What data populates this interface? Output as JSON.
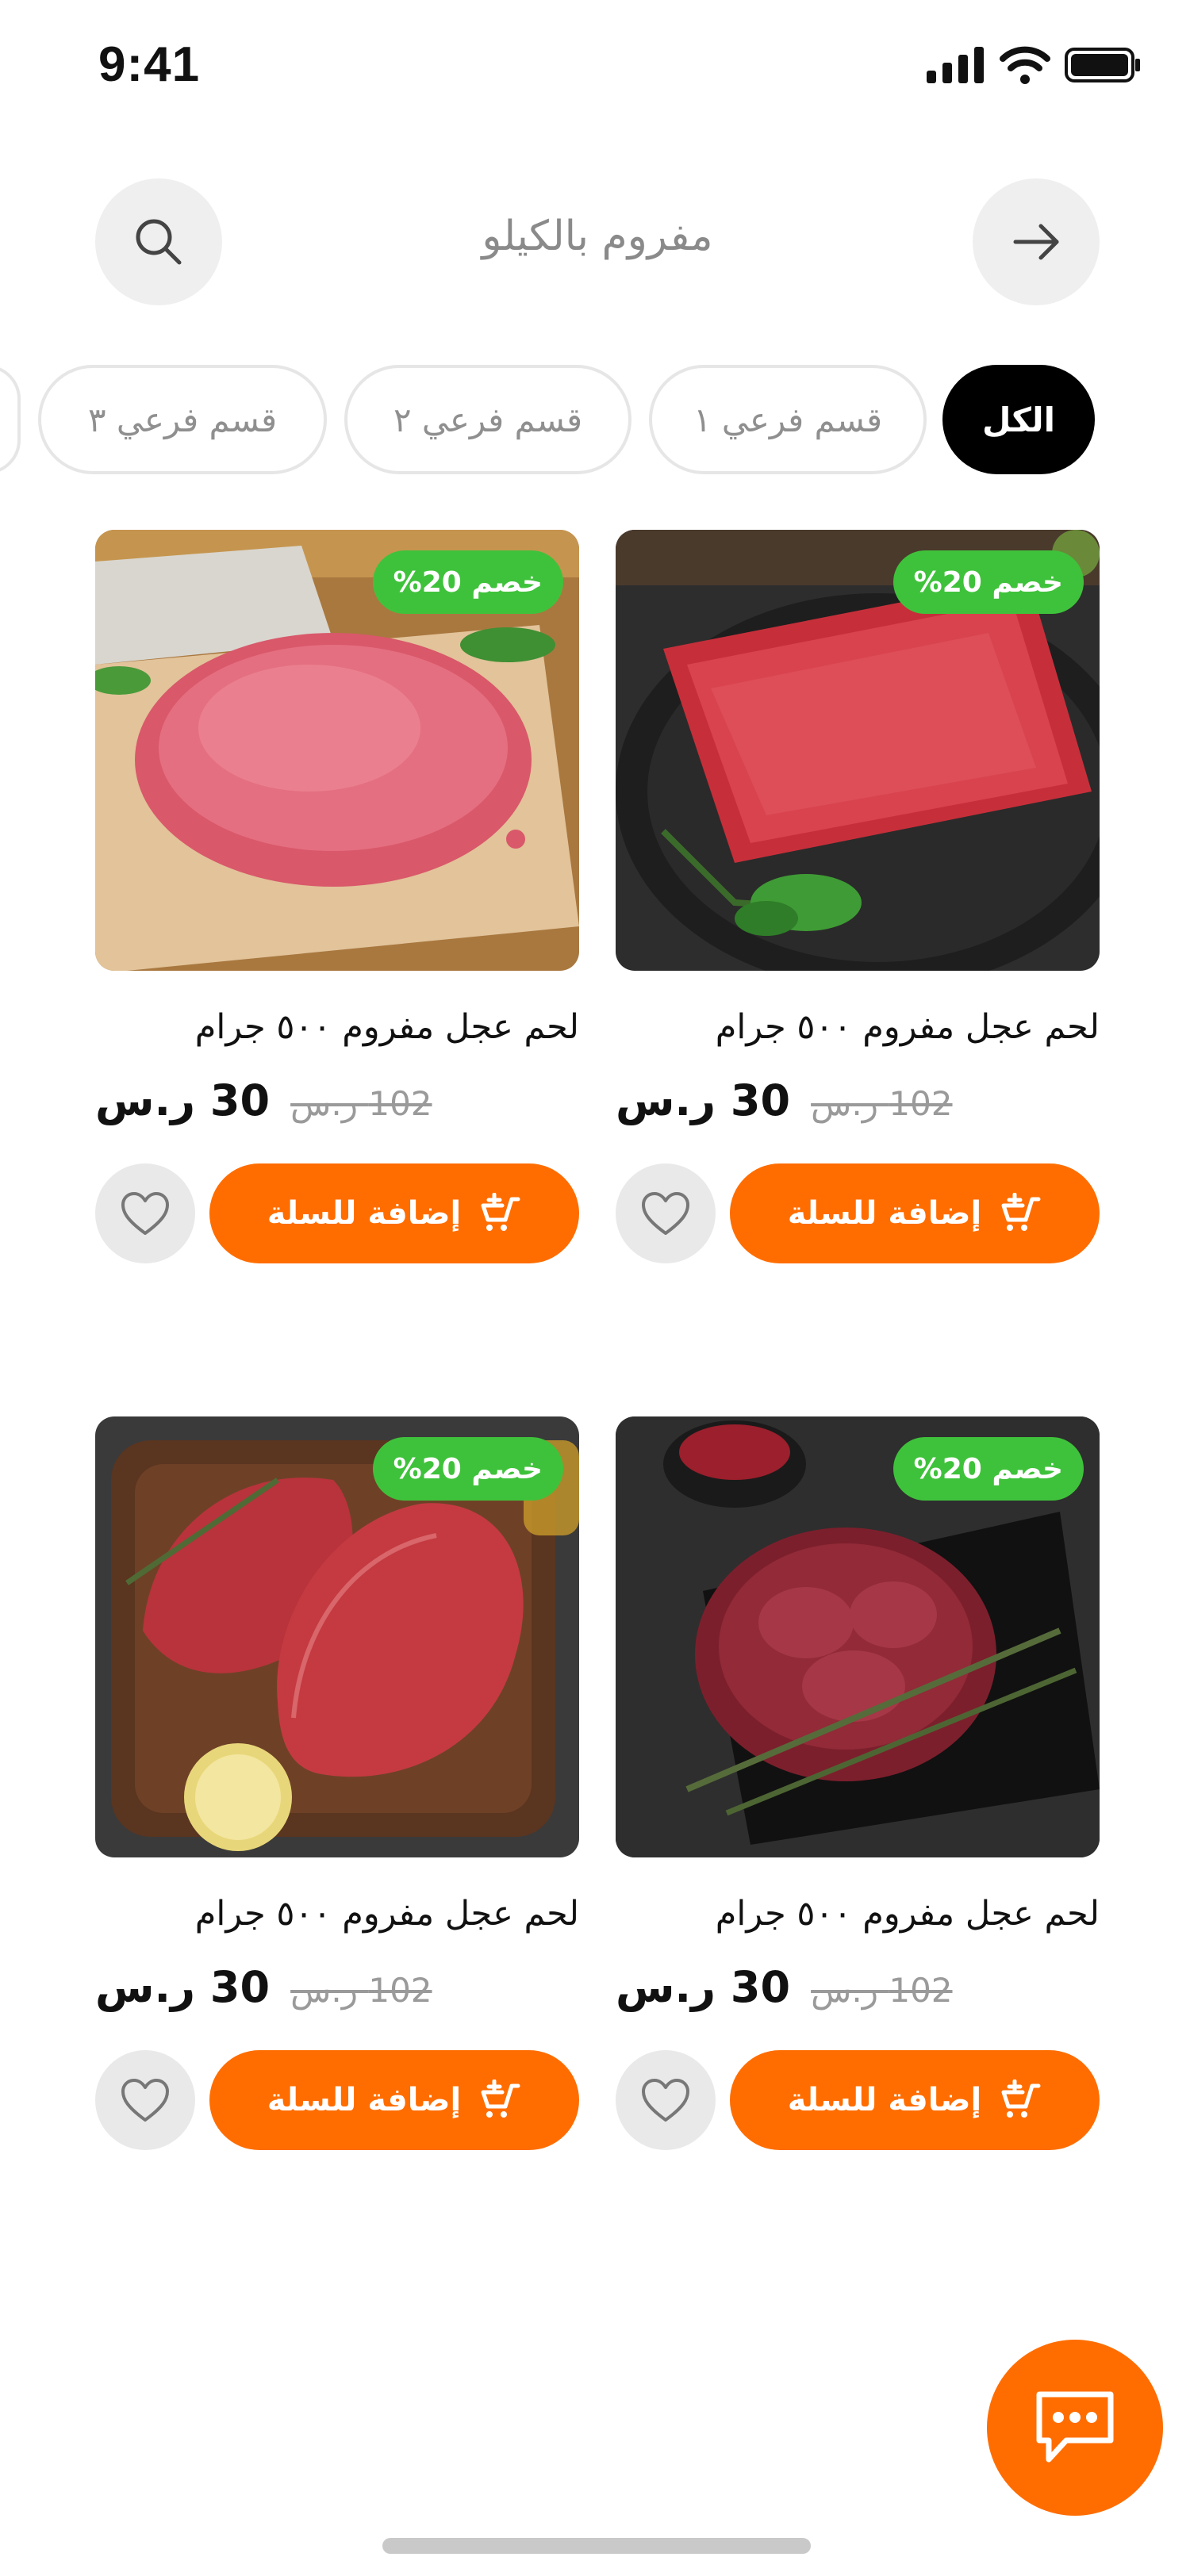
{
  "status_bar": {
    "time": "9:41"
  },
  "header": {
    "title": "مفروم بالكيلو"
  },
  "filters": [
    {
      "label": "الكل",
      "active": true
    },
    {
      "label": "قسم فرعي ١",
      "active": false
    },
    {
      "label": "قسم فرعي ٢",
      "active": false
    },
    {
      "label": "قسم فرعي ٣",
      "active": false
    },
    {
      "label": "",
      "active": false
    }
  ],
  "products": [
    {
      "title": "لحم عجل مفروم ٥٠٠ جرام",
      "price": "30 ر.س",
      "old_price": "102 ر.س",
      "discount": "خصم 20%",
      "add_label": "إضافة للسلة",
      "image": "minced-meat-tray-image"
    },
    {
      "title": "لحم عجل مفروم ٥٠٠ جرام",
      "price": "30 ر.س",
      "old_price": "102 ر.س",
      "discount": "خصم 20%",
      "add_label": "إضافة للسلة",
      "image": "minced-meat-paper-image"
    },
    {
      "title": "لحم عجل مفروم ٥٠٠ جرام",
      "price": "30 ر.س",
      "old_price": "102 ر.س",
      "discount": "خصم 20%",
      "add_label": "إضافة للسلة",
      "image": "liver-rosemary-image"
    },
    {
      "title": "لحم عجل مفروم ٥٠٠ جرام",
      "price": "30 ر.س",
      "old_price": "102 ر.س",
      "discount": "خصم 20%",
      "add_label": "إضافة للسلة",
      "image": "steaks-board-image"
    }
  ],
  "colors": {
    "accent": "#ff6d00",
    "badge": "#3fc23b",
    "active_chip": "#000000",
    "chip_border": "#e6e6e6"
  },
  "icons": {
    "search": "search-icon",
    "back": "arrow-right-icon",
    "favorite": "heart-icon",
    "cart": "cart-plus-icon",
    "chat": "chat-bubble-icon"
  }
}
